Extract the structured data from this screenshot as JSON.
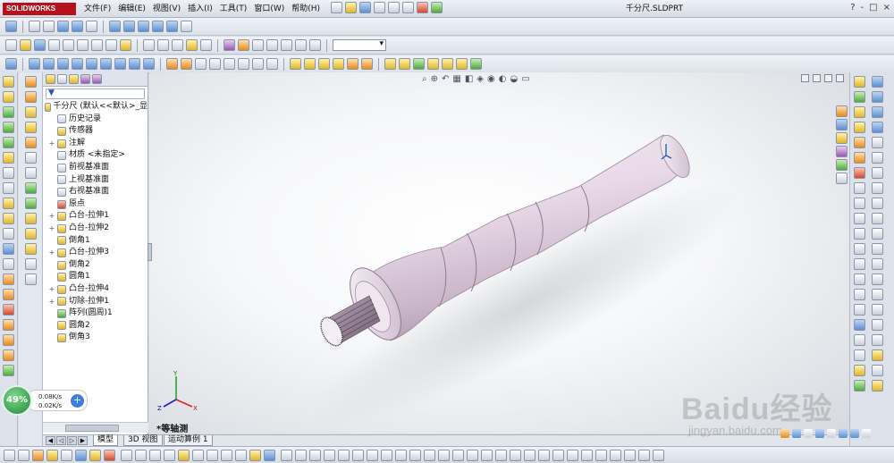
{
  "app": {
    "brand": "SOLIDWORKS",
    "document_title": "千分尺.SLDPRT"
  },
  "menu": [
    {
      "label": "文件(F)"
    },
    {
      "label": "编辑(E)"
    },
    {
      "label": "视图(V)"
    },
    {
      "label": "插入(I)"
    },
    {
      "label": "工具(T)"
    },
    {
      "label": "窗口(W)"
    },
    {
      "label": "帮助(H)"
    }
  ],
  "window_controls": [
    "?",
    "-",
    "□",
    "×"
  ],
  "feature_tree": {
    "root": "千分尺 (默认<<默认>_显",
    "items": [
      {
        "label": "历史记录",
        "icon": "history-icon",
        "expander": ""
      },
      {
        "label": "传感器",
        "icon": "sensor-icon",
        "expander": ""
      },
      {
        "label": "注解",
        "icon": "annotation-icon",
        "expander": "+"
      },
      {
        "label": "材质 <未指定>",
        "icon": "material-icon",
        "expander": ""
      },
      {
        "label": "前视基准面",
        "icon": "plane-icon",
        "expander": ""
      },
      {
        "label": "上视基准面",
        "icon": "plane-icon",
        "expander": ""
      },
      {
        "label": "右视基准面",
        "icon": "plane-icon",
        "expander": ""
      },
      {
        "label": "原点",
        "icon": "origin-icon",
        "expander": ""
      },
      {
        "label": "凸台-拉伸1",
        "icon": "extrude-icon",
        "expander": "+"
      },
      {
        "label": "凸台-拉伸2",
        "icon": "extrude-icon",
        "expander": "+"
      },
      {
        "label": "倒角1",
        "icon": "chamfer-icon",
        "expander": ""
      },
      {
        "label": "凸台-拉伸3",
        "icon": "extrude-icon",
        "expander": "+"
      },
      {
        "label": "倒角2",
        "icon": "chamfer-icon",
        "expander": ""
      },
      {
        "label": "圆角1",
        "icon": "fillet-icon",
        "expander": ""
      },
      {
        "label": "凸台-拉伸4",
        "icon": "extrude-icon",
        "expander": "+"
      },
      {
        "label": "切除-拉伸1",
        "icon": "cut-extrude-icon",
        "expander": "+"
      },
      {
        "label": "阵列(圆周)1",
        "icon": "circular-pattern-icon",
        "expander": ""
      },
      {
        "label": "圆角2",
        "icon": "fillet-icon",
        "expander": ""
      },
      {
        "label": "倒角3",
        "icon": "chamfer-icon",
        "expander": ""
      }
    ]
  },
  "viewport": {
    "view_name": "*等轴测"
  },
  "bottom_tabs": [
    {
      "label": "模型",
      "active": true
    },
    {
      "label": "3D 视图",
      "active": false
    },
    {
      "label": "运动算例 1",
      "active": false
    }
  ],
  "network_widget": {
    "percent": "49%",
    "upload": "0.08K/s",
    "download": "0.02K/s"
  },
  "watermark": {
    "text": "Baidu经验",
    "url": "jingyan.baidu.com"
  },
  "colors": {
    "brand_red": "#b5121b",
    "part_color": "#e6d6e6",
    "viewport_bg": "#f4f5f7"
  }
}
